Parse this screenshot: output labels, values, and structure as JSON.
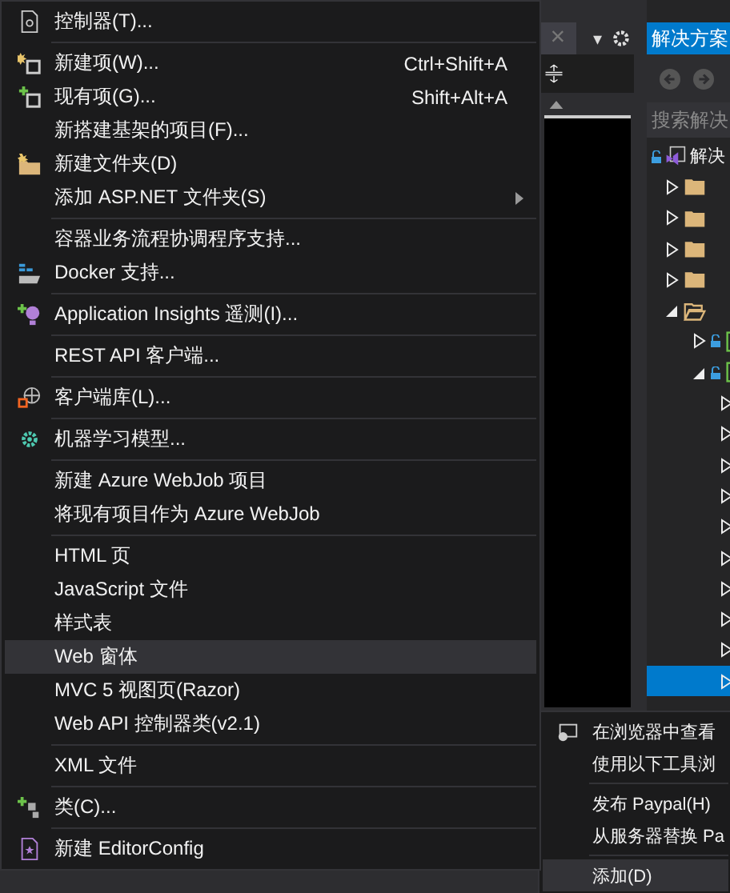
{
  "editor": {
    "close_tab": "×",
    "dropdown": "▾"
  },
  "solution_explorer": {
    "title": "解决方案",
    "search": {
      "placeholder": "搜索解决"
    },
    "tree": [
      {
        "kind": "solution",
        "label": "解决",
        "selected": false,
        "children": [
          {
            "kind": "folder",
            "expanded": false,
            "selected": false
          },
          {
            "kind": "folder",
            "expanded": false,
            "selected": false
          },
          {
            "kind": "folder",
            "expanded": false,
            "selected": false
          },
          {
            "kind": "folder",
            "expanded": false,
            "selected": false
          },
          {
            "kind": "folder",
            "expanded": true,
            "selected": false,
            "children": [
              {
                "kind": "project",
                "expanded": false,
                "selected": false
              },
              {
                "kind": "project",
                "expanded": true,
                "selected": false,
                "children": [
                  {
                    "expanded": false,
                    "selected": false
                  },
                  {
                    "expanded": false,
                    "selected": false
                  },
                  {
                    "expanded": false,
                    "selected": false
                  },
                  {
                    "expanded": false,
                    "selected": false
                  },
                  {
                    "expanded": false,
                    "selected": false
                  },
                  {
                    "expanded": false,
                    "selected": false
                  },
                  {
                    "expanded": false,
                    "selected": false
                  },
                  {
                    "expanded": false,
                    "selected": false
                  },
                  {
                    "expanded": false,
                    "selected": false
                  },
                  {
                    "expanded": false,
                    "selected": true
                  }
                ]
              }
            ]
          }
        ]
      }
    ]
  },
  "context_menu": [
    {
      "kind": "item",
      "label": "控制器(T)...",
      "selected": false
    },
    {
      "kind": "separator"
    },
    {
      "kind": "item",
      "label": "新建项(W)...",
      "shortcut": "Ctrl+Shift+A",
      "selected": false
    },
    {
      "kind": "item",
      "label": "现有项(G)...",
      "shortcut": "Shift+Alt+A",
      "selected": false
    },
    {
      "kind": "item",
      "label": "新搭建基架的项目(F)...",
      "selected": false
    },
    {
      "kind": "item",
      "label": "新建文件夹(D)",
      "selected": false
    },
    {
      "kind": "item",
      "label": "添加 ASP.NET 文件夹(S)",
      "submenu": true,
      "selected": false
    },
    {
      "kind": "separator"
    },
    {
      "kind": "item",
      "label": "容器业务流程协调程序支持...",
      "selected": false
    },
    {
      "kind": "item",
      "label": "Docker 支持...",
      "selected": false
    },
    {
      "kind": "separator"
    },
    {
      "kind": "item",
      "label": "Application Insights 遥测(I)...",
      "selected": false
    },
    {
      "kind": "separator"
    },
    {
      "kind": "item",
      "label": "REST API 客户端...",
      "selected": false
    },
    {
      "kind": "separator"
    },
    {
      "kind": "item",
      "label": "客户端库(L)...",
      "selected": false
    },
    {
      "kind": "separator"
    },
    {
      "kind": "item",
      "label": "机器学习模型...",
      "selected": false
    },
    {
      "kind": "separator"
    },
    {
      "kind": "item",
      "label": "新建 Azure WebJob 项目",
      "selected": false
    },
    {
      "kind": "item",
      "label": "将现有项目作为 Azure WebJob",
      "selected": false
    },
    {
      "kind": "separator"
    },
    {
      "kind": "item",
      "label": "HTML 页",
      "selected": false
    },
    {
      "kind": "item",
      "label": "JavaScript 文件",
      "selected": false
    },
    {
      "kind": "item",
      "label": "样式表",
      "selected": false
    },
    {
      "kind": "item",
      "label": "Web 窗体",
      "selected": true
    },
    {
      "kind": "item",
      "label": "MVC 5 视图页(Razor)",
      "selected": false
    },
    {
      "kind": "item",
      "label": "Web API 控制器类(v2.1)",
      "selected": false
    },
    {
      "kind": "separator"
    },
    {
      "kind": "item",
      "label": "XML 文件",
      "selected": false
    },
    {
      "kind": "separator"
    },
    {
      "kind": "item",
      "label": "类(C)...",
      "selected": false
    },
    {
      "kind": "separator"
    },
    {
      "kind": "item",
      "label": "新建 EditorConfig",
      "selected": false
    }
  ],
  "parent_menu": [
    {
      "kind": "item",
      "label": "在浏览器中查看",
      "selected": false
    },
    {
      "kind": "item",
      "label": "使用以下工具浏",
      "selected": false
    },
    {
      "kind": "separator"
    },
    {
      "kind": "item",
      "label": "发布 Paypal(H)",
      "selected": false
    },
    {
      "kind": "item",
      "label": "从服务器替换 Pa",
      "selected": false
    },
    {
      "kind": "separator"
    },
    {
      "kind": "item",
      "label": "添加(D)",
      "selected": true
    }
  ]
}
